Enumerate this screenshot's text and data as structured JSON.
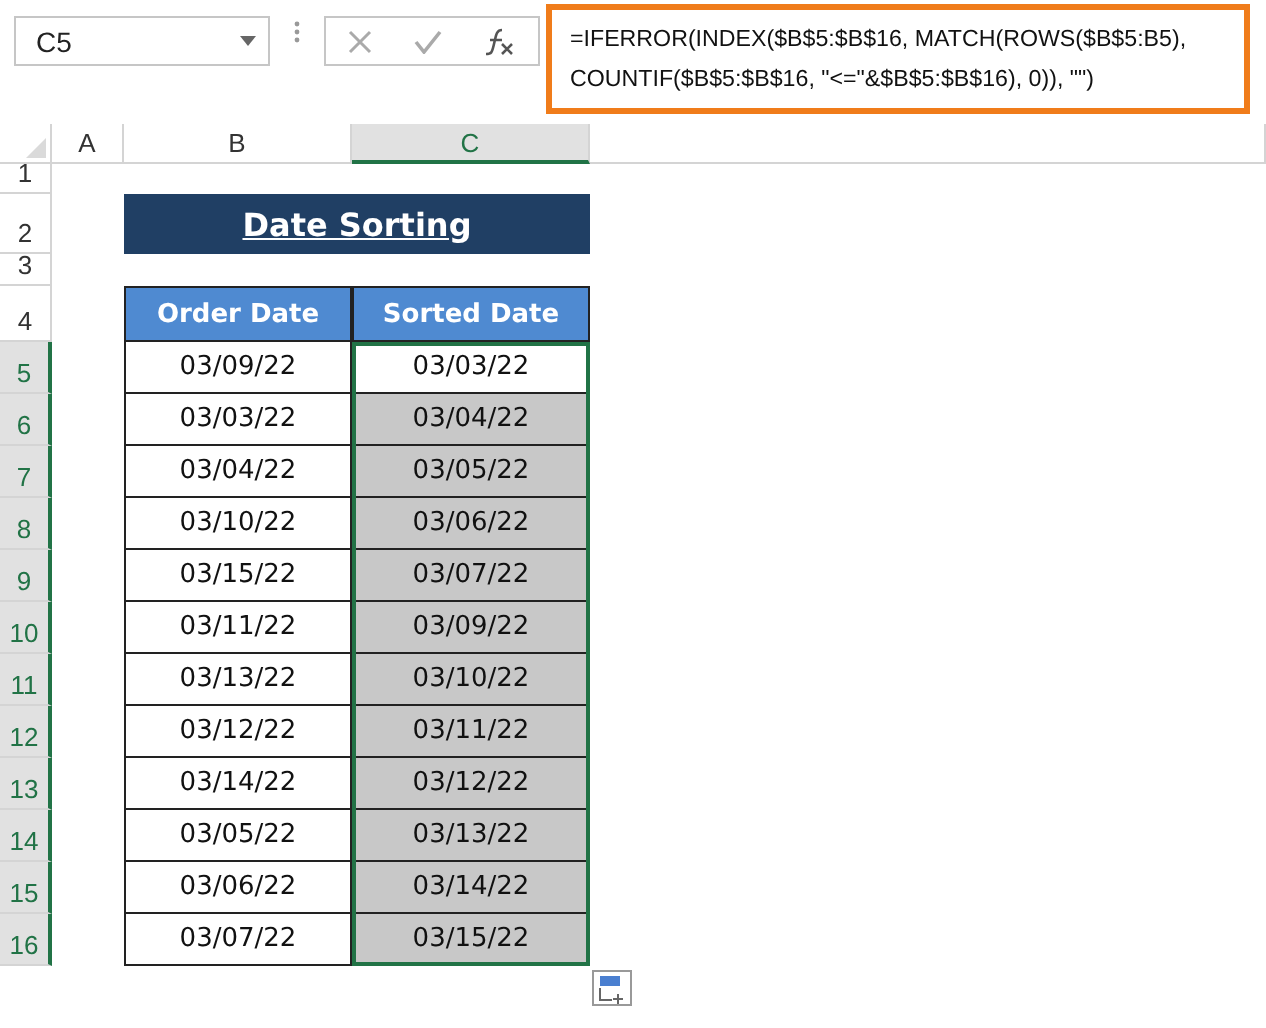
{
  "name_box": {
    "value": "C5"
  },
  "formula_bar": {
    "formula": "=IFERROR(INDEX($B$5:$B$16, MATCH(ROWS($B$5:B5), COUNTIF($B$5:$B$16, \"<=\"&$B$5:$B$16), 0)), \"\")"
  },
  "columns": [
    {
      "label": "A",
      "selected": false
    },
    {
      "label": "B",
      "selected": false
    },
    {
      "label": "C",
      "selected": true
    }
  ],
  "title_row": {
    "row": "1",
    "title_row_label": "2",
    "gap_row": "3",
    "header_row": "4",
    "title": "Date Sorting"
  },
  "table": {
    "headers": [
      "Order Date",
      "Sorted Date"
    ],
    "rows": [
      {
        "row": "5",
        "order_date": "03/09/22",
        "sorted_date": "03/03/22",
        "selected": true,
        "active": true
      },
      {
        "row": "6",
        "order_date": "03/03/22",
        "sorted_date": "03/04/22",
        "selected": true,
        "active": false
      },
      {
        "row": "7",
        "order_date": "03/04/22",
        "sorted_date": "03/05/22",
        "selected": true,
        "active": false
      },
      {
        "row": "8",
        "order_date": "03/10/22",
        "sorted_date": "03/06/22",
        "selected": true,
        "active": false
      },
      {
        "row": "9",
        "order_date": "03/15/22",
        "sorted_date": "03/07/22",
        "selected": true,
        "active": false
      },
      {
        "row": "10",
        "order_date": "03/11/22",
        "sorted_date": "03/09/22",
        "selected": true,
        "active": false
      },
      {
        "row": "11",
        "order_date": "03/13/22",
        "sorted_date": "03/10/22",
        "selected": true,
        "active": false
      },
      {
        "row": "12",
        "order_date": "03/12/22",
        "sorted_date": "03/11/22",
        "selected": true,
        "active": false
      },
      {
        "row": "13",
        "order_date": "03/14/22",
        "sorted_date": "03/12/22",
        "selected": true,
        "active": false
      },
      {
        "row": "14",
        "order_date": "03/05/22",
        "sorted_date": "03/13/22",
        "selected": true,
        "active": false
      },
      {
        "row": "15",
        "order_date": "03/06/22",
        "sorted_date": "03/14/22",
        "selected": true,
        "active": false
      },
      {
        "row": "16",
        "order_date": "03/07/22",
        "sorted_date": "03/15/22",
        "selected": true,
        "active": false
      }
    ]
  }
}
